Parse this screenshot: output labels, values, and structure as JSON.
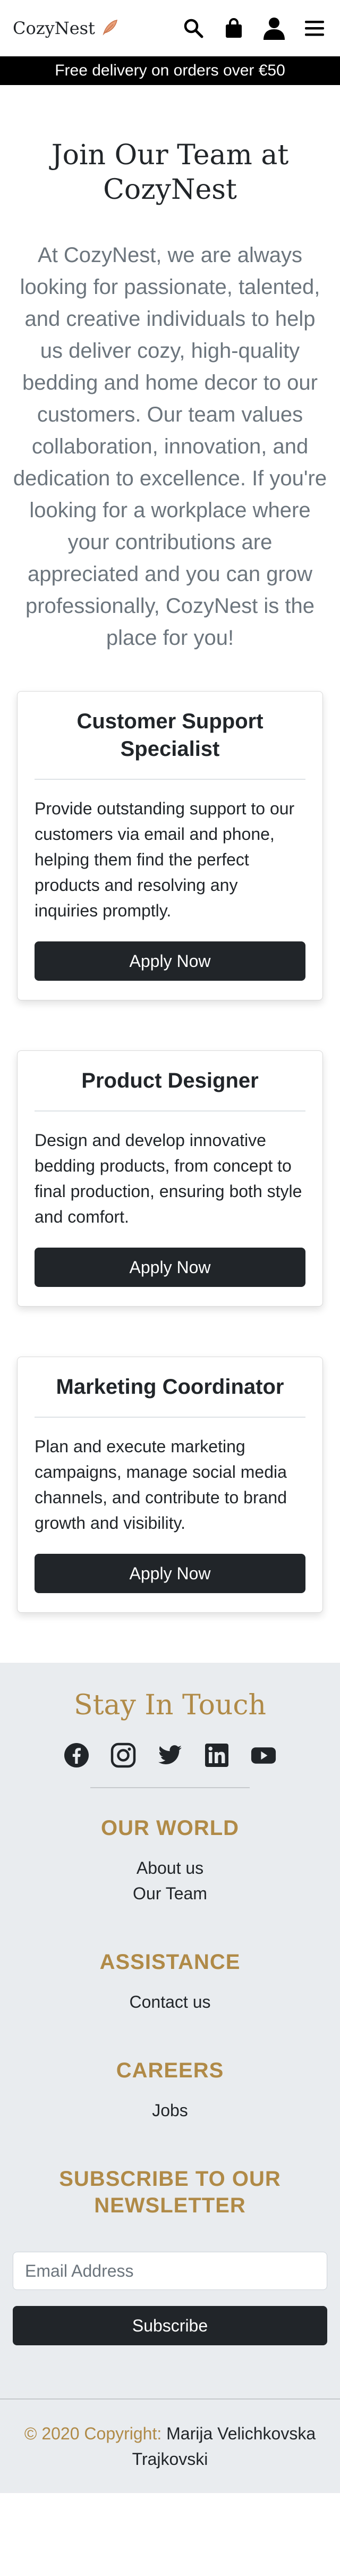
{
  "brand": {
    "name": "CozyNest",
    "logo_icon": "feather-icon"
  },
  "header_icons": [
    "search-icon",
    "shopping-bag-icon",
    "user-icon",
    "menu-icon"
  ],
  "promo": {
    "text": "Free delivery on orders over €50"
  },
  "intro": {
    "title": "Join Our Team at CozyNest",
    "text": "At CozyNest, we are always looking for passionate, talented, and creative individuals to help us deliver cozy, high-quality bedding and home decor to our customers. Our team values collaboration, innovation, and dedication to excellence. If you're looking for a workplace where your contributions are appreciated and you can grow professionally, CozyNest is the place for you!"
  },
  "jobs": [
    {
      "title": "Customer Support Specialist",
      "description": "Provide outstanding support to our customers via email and phone, helping them find the perfect products and resolving any inquiries promptly.",
      "button": "Apply Now"
    },
    {
      "title": "Product Designer",
      "description": "Design and develop innovative bedding products, from concept to final production, ensuring both style and comfort.",
      "button": "Apply Now"
    },
    {
      "title": "Marketing Coordinator",
      "description": "Plan and execute marketing campaigns, manage social media channels, and contribute to brand growth and visibility.",
      "button": "Apply Now"
    }
  ],
  "footer": {
    "stay_in_touch": "Stay In Touch",
    "socials": [
      "facebook-icon",
      "instagram-icon",
      "twitter-icon",
      "linkedin-icon",
      "youtube-icon"
    ],
    "sections": [
      {
        "heading": "OUR WORLD",
        "links": [
          "About us",
          "Our Team"
        ]
      },
      {
        "heading": "ASSISTANCE",
        "links": [
          "Contact us"
        ]
      },
      {
        "heading": "CAREERS",
        "links": [
          "Jobs"
        ]
      }
    ],
    "newsletter": {
      "heading": "SUBSCRIBE TO OUR NEWSLETTER",
      "placeholder": "Email Address",
      "button": "Subscribe"
    },
    "copyright": {
      "prefix": "© 2020 Copyright:",
      "author": "Marija Velichkovska Trajkovski"
    }
  },
  "colors": {
    "accent": "#b08a47",
    "dark": "#212529",
    "footer_bg": "#e9ecef",
    "promo_bg": "#000000"
  }
}
